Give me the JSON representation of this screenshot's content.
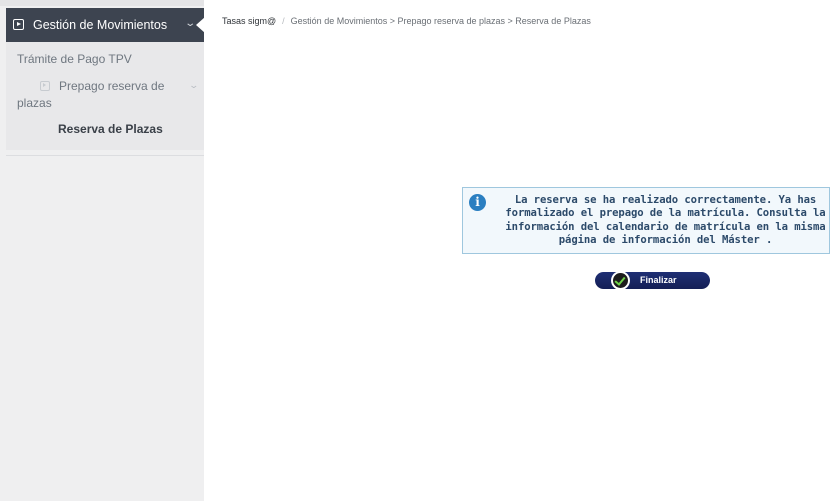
{
  "sidebar": {
    "active_item": {
      "label": "Gestión de Movimientos",
      "icon": "play-square-icon",
      "chevron": "⌄"
    },
    "items": [
      {
        "label": "Trámite de Pago TPV"
      },
      {
        "label": "Prepago reserva de",
        "label_line2": "plazas",
        "icon": "play-square-icon",
        "chevron": "⌄"
      },
      {
        "label": "Reserva de Plazas"
      }
    ]
  },
  "breadcrumb": {
    "home": "Tasas sigm@",
    "separator": "/",
    "path": "Gestión de Movimientos > Prepago reserva de plazas > Reserva de Plazas"
  },
  "message": {
    "icon": "info-icon",
    "icon_glyph": "i",
    "text": "La reserva se ha realizado correctamente. Ya has formalizado el prepago de la matrícula. Consulta la información del calendario de matrícula en la misma página de información del Máster ."
  },
  "actions": {
    "finish_label": "Finalizar",
    "finish_icon": "check-circle-icon"
  },
  "colors": {
    "sidebar_active_bg": "#3d4450",
    "info_border": "#9fc7de",
    "info_icon": "#2b7fc1",
    "button_bg": "#1f2f74",
    "check_green": "#6fd24a"
  }
}
